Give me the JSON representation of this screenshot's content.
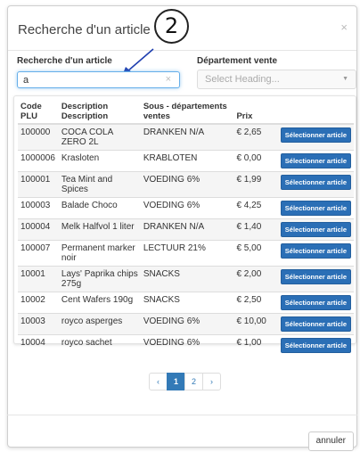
{
  "modal": {
    "title": "Recherche d'un article",
    "close_icon": "close-icon"
  },
  "annotation": {
    "number": "2",
    "color": "#1f3fb0"
  },
  "search": {
    "label": "Recherche d'un article",
    "value": "a"
  },
  "department": {
    "label": "Département vente",
    "placeholder": "Select Heading..."
  },
  "table": {
    "headers": {
      "code": "Code PLU",
      "description": "Description Description",
      "subdept": "Sous - départements ventes",
      "price": "Prix"
    },
    "button_label": "Sélectionner article",
    "rows": [
      {
        "code": "100000",
        "description": "COCA COLA ZERO 2L",
        "subdept": "DRANKEN N/A",
        "price": "€ 2,65"
      },
      {
        "code": "1000006",
        "description": "Krasloten",
        "subdept": "KRABLOTEN",
        "price": "€ 0,00"
      },
      {
        "code": "100001",
        "description": "Tea Mint and Spices",
        "subdept": "VOEDING 6%",
        "price": "€ 1,99"
      },
      {
        "code": "100003",
        "description": "Balade Choco",
        "subdept": "VOEDING 6%",
        "price": "€ 4,25"
      },
      {
        "code": "100004",
        "description": "Melk Halfvol 1 liter",
        "subdept": "DRANKEN N/A",
        "price": "€ 1,40"
      },
      {
        "code": "100007",
        "description": "Permanent marker noir",
        "subdept": "LECTUUR 21%",
        "price": "€ 5,00"
      },
      {
        "code": "10001",
        "description": "Lays' Paprika chips 275g",
        "subdept": "SNACKS",
        "price": "€ 2,00"
      },
      {
        "code": "10002",
        "description": "Cent Wafers 190g",
        "subdept": "SNACKS",
        "price": "€ 2,50"
      },
      {
        "code": "10003",
        "description": "royco asperges",
        "subdept": "VOEDING 6%",
        "price": "€ 10,00"
      },
      {
        "code": "10004",
        "description": "royco sachet",
        "subdept": "VOEDING 6%",
        "price": "€ 1,00"
      }
    ]
  },
  "pagination": {
    "prev": "‹",
    "pages": [
      "1",
      "2"
    ],
    "active_page": "1",
    "next": "›"
  },
  "footer": {
    "cancel_label": "annuler"
  },
  "colors": {
    "primary": "#337ab7",
    "button": "#2b6fb6"
  }
}
